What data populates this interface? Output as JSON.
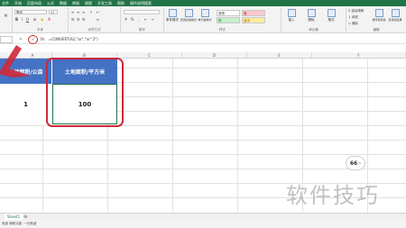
{
  "menu": {
    "items": [
      "文件",
      "开始",
      "页面布局",
      "公式",
      "数据",
      "审阅",
      "视图",
      "开发工具",
      "帮助",
      "操作说明搜索"
    ]
  },
  "ribbon": {
    "font_name": "等线",
    "font_size": "11",
    "groups": {
      "font": "字体",
      "alignment": "对齐方式",
      "number": "数字",
      "styles": "样式",
      "cells": "单元格",
      "editing": "编辑"
    },
    "style_cells": [
      {
        "label": "常规",
        "color": "#ffffff"
      },
      {
        "label": "差",
        "color": "#ffc7ce"
      },
      {
        "label": "好",
        "color": "#c6efce"
      },
      {
        "label": "适中",
        "color": "#ffeb9c"
      }
    ],
    "conditional_format": "条件格式",
    "table_format": "套用表格格式",
    "cell_styles": "单元格样式",
    "insert": "插入",
    "delete": "删除",
    "format": "格式",
    "autosum": "自动求和",
    "fill": "填充",
    "clear": "清除",
    "sort_filter": "排序和筛选",
    "find_select": "查找和选择"
  },
  "formula_bar": {
    "cancel_glyph": "✕",
    "enter_glyph": "✓",
    "fx_glyph": "fx",
    "formula": "=CONVERT(A2,\"ar\",\"m^2\")"
  },
  "columns": [
    "A",
    "B",
    "C",
    "D",
    "E",
    "F"
  ],
  "table": {
    "header_a": "土地面积/公亩",
    "header_b": "土地面积/平方米",
    "value_a": "1",
    "value_b": "100"
  },
  "sheet_tab": "Sheet1",
  "add_sheet_glyph": "⊕",
  "status_text": "就绪   辅助功能: 一切就绪",
  "overlay": {
    "watermark": "软件技巧",
    "speed_value": "66",
    "speed_unit": "%"
  },
  "colors": {
    "accent": "#217346",
    "header_fill": "#4472c4",
    "highlight": "#d0283a"
  }
}
